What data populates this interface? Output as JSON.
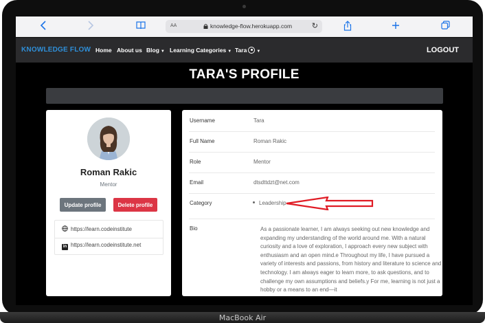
{
  "browser": {
    "url": "knowledge-flow.herokuapp.com",
    "text_size_label": "AA"
  },
  "nav": {
    "brand": "KNOWLEDGE FLOW",
    "items": [
      {
        "label": "Home"
      },
      {
        "label": "About us"
      },
      {
        "label": "Blog"
      },
      {
        "label": "Learning Categories"
      },
      {
        "label": "Tara"
      }
    ],
    "logout": "LOGOUT"
  },
  "page": {
    "title": "TARA'S PROFILE"
  },
  "profile": {
    "name": "Roman Rakic",
    "role": "Mentor",
    "update_button": "Update profile",
    "delete_button": "Delete profile",
    "links": [
      {
        "icon": "globe-icon",
        "url": "https://learn.codeinstitute"
      },
      {
        "icon": "linkedin-icon",
        "url": "https://learn.codeinstitute.net"
      }
    ]
  },
  "details": {
    "username": {
      "label": "Username",
      "value": "Tara"
    },
    "full_name": {
      "label": "Full Name",
      "value": "Roman Rakic"
    },
    "role": {
      "label": "Role",
      "value": "Mentor"
    },
    "email": {
      "label": "Email",
      "value": "dtsdttdzt@net.com"
    },
    "category": {
      "label": "Category",
      "value": "Leadership"
    },
    "bio": {
      "label": "Bio",
      "value": "As a passionate learner, I am always seeking out new knowledge and expanding my understanding of the world around me. With a natural curiosity and a love of exploration, I approach every new subject with enthusiasm and an open mind.e Throughout my life, I have pursued a variety of interests and passions, from history and literature to science and technology. I am always eager to learn more, to ask questions, and to challenge my own assumptions and beliefs.y For me, learning is not just a hobby or a means to an end—it"
    }
  },
  "device": {
    "label": "MacBook Air"
  },
  "colors": {
    "brand": "#2f8fd8",
    "nav_bg": "#2b2b2d",
    "delete": "#dc3545",
    "update": "#6c757d",
    "annotation_arrow": "#e01b24"
  }
}
